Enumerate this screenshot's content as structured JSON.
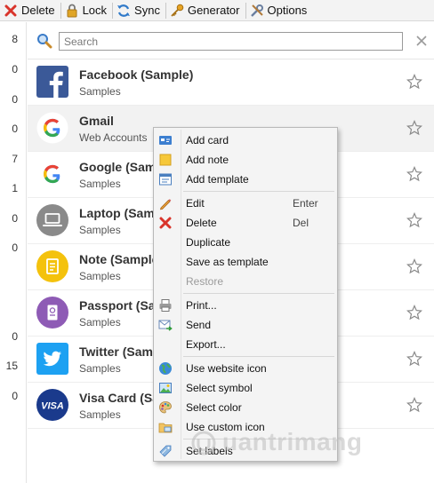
{
  "toolbar": {
    "delete_label": "Delete",
    "lock_label": "Lock",
    "sync_label": "Sync",
    "generator_label": "Generator",
    "options_label": "Options"
  },
  "counts": [
    "8",
    "0",
    "0",
    "0",
    "7",
    "1",
    "0",
    "0",
    "0",
    "15",
    "0"
  ],
  "search": {
    "placeholder": "Search"
  },
  "entries": [
    {
      "title": "Facebook (Sample)",
      "subtitle": "Samples",
      "icon": "facebook-icon"
    },
    {
      "title": "Gmail",
      "subtitle": "Web Accounts",
      "icon": "google-icon"
    },
    {
      "title": "Google (Sam",
      "subtitle": "Samples",
      "icon": "google-icon"
    },
    {
      "title": "Laptop (Sam",
      "subtitle": "Samples",
      "icon": "laptop-icon"
    },
    {
      "title": "Note (Sample",
      "subtitle": "Samples",
      "icon": "note-icon"
    },
    {
      "title": "Passport (Sa",
      "subtitle": "Samples",
      "icon": "passport-icon"
    },
    {
      "title": "Twitter (Sam",
      "subtitle": "Samples",
      "icon": "twitter-icon"
    },
    {
      "title": "Visa Card (Sa",
      "subtitle": "Samples",
      "icon": "visa-icon"
    }
  ],
  "visa_logo_text": "VISA",
  "context_menu": {
    "add_card": "Add card",
    "add_note": "Add note",
    "add_template": "Add template",
    "edit": "Edit",
    "edit_shortcut": "Enter",
    "delete": "Delete",
    "delete_shortcut": "Del",
    "duplicate": "Duplicate",
    "save_as_template": "Save as template",
    "restore": "Restore",
    "print": "Print...",
    "send": "Send",
    "export": "Export...",
    "use_website_icon": "Use website icon",
    "select_symbol": "Select symbol",
    "select_color": "Select color",
    "use_custom_icon": "Use custom icon",
    "set_labels": "Set labels"
  },
  "watermark": "uantrimang",
  "colors": {
    "facebook": "#3b5998",
    "twitter": "#1da1f2",
    "visa": "#1a3a8c",
    "laptop": "#8a8a8a",
    "note": "#f4c20d",
    "passport": "#8e5bb5",
    "delete_red": "#d9342b"
  }
}
